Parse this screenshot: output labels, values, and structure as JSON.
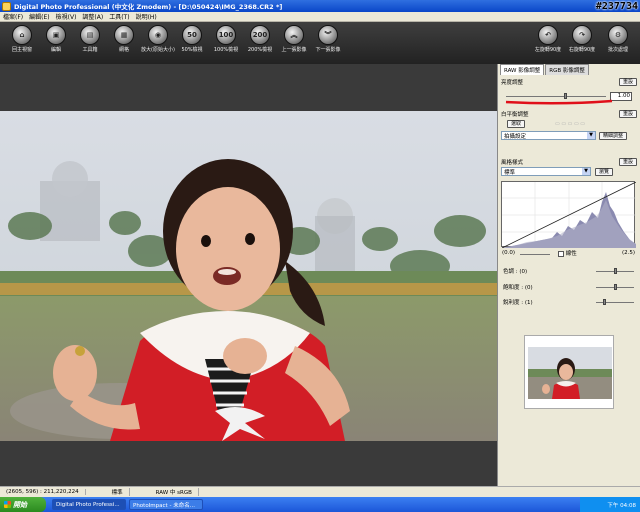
{
  "window": {
    "title": "Digital Photo Professional (中文化 Zmodem) - [D:\\050424\\IMG_2368.CR2 *]",
    "watermark": "#237734"
  },
  "menu": [
    "檔案(F)",
    "編輯(E)",
    "檢視(V)",
    "調整(A)",
    "工具(T)",
    "說明(H)"
  ],
  "toolbar": {
    "left": [
      {
        "label": "回主視窗",
        "icon": "home-icon"
      },
      {
        "label": "編輯",
        "icon": "edit-icon"
      },
      {
        "label": "工具箱",
        "icon": "toolbox-icon"
      },
      {
        "label": "網格",
        "icon": "grid-icon"
      },
      {
        "label": "放大(原始大小)",
        "icon": "zoom-icon"
      },
      {
        "label": "50%檢視",
        "icon": "view-50-icon"
      },
      {
        "label": "100%檢視",
        "icon": "view-100-icon"
      },
      {
        "label": "200%檢視",
        "icon": "view-200-icon"
      },
      {
        "label": "上一張影像",
        "icon": "prev-image-icon"
      },
      {
        "label": "下一張影像",
        "icon": "next-image-icon"
      }
    ],
    "right": [
      {
        "label": "左旋轉90度",
        "icon": "rotate-left-icon"
      },
      {
        "label": "右旋轉90度",
        "icon": "rotate-right-icon"
      },
      {
        "label": "批次處理",
        "icon": "batch-icon"
      }
    ]
  },
  "panel": {
    "tabs": [
      "RAW 影像調整",
      "RGB 影像調整"
    ],
    "brightness": {
      "title": "亮度調整",
      "reset": "重設",
      "value": "1.00",
      "level": 0.58
    },
    "wb": {
      "title": "白平衡調整",
      "reset": "重設",
      "pick": "選取",
      "preset": "拍攝設定",
      "fine": "精細調整"
    },
    "style": {
      "title": "風格樣式",
      "reset": "重設",
      "preset": "標準",
      "browse": "瀏覽"
    },
    "curve": {
      "left": "(0.0)",
      "right": "(2.5)",
      "linear": "線性"
    },
    "sliders": [
      {
        "label": "色調 : (0)",
        "level": 0.5
      },
      {
        "label": "飽和度 : (0)",
        "level": 0.5
      },
      {
        "label": "銳利度 : (1)",
        "level": 0.2
      }
    ]
  },
  "status": [
    "(2605, 596) : 211,220,224",
    "標準",
    "RAW 中 sRGB"
  ],
  "taskbar": {
    "start": "開始",
    "tasks": [
      "Digital Photo Professi...",
      "PhotoImpact - 未命名..."
    ],
    "clock": "下午 04:08"
  }
}
